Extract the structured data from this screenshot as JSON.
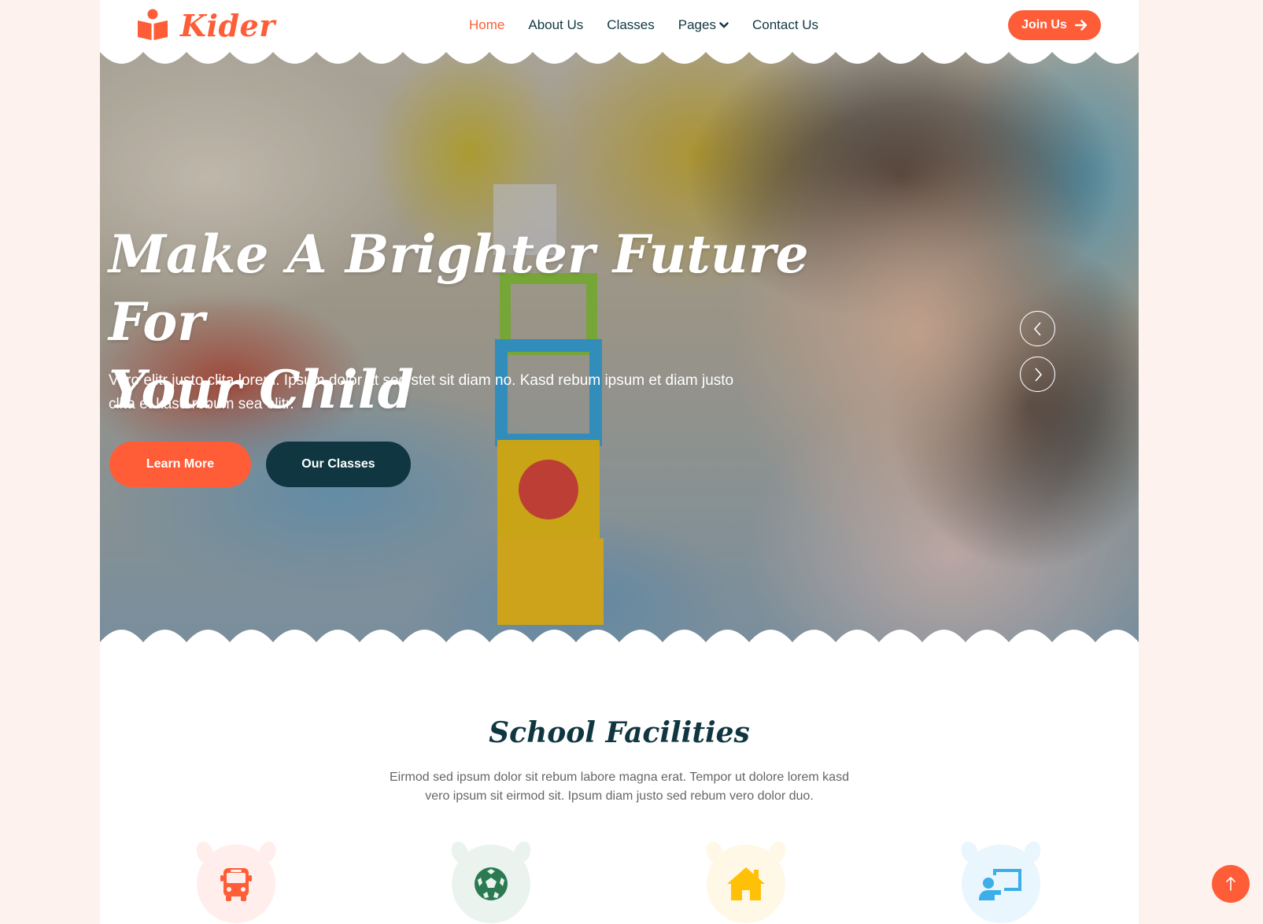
{
  "brand": {
    "name": "Kider",
    "icon": "book-reader-icon",
    "color": "#fe5d37"
  },
  "nav": {
    "home": "Home",
    "about": "About Us",
    "classes": "Classes",
    "pages": "Pages",
    "contact": "Contact Us",
    "join": "Join Us"
  },
  "hero": {
    "title_line1": "Make A Brighter Future For",
    "title_line2": "Your Child",
    "text_line1": "Vero elitr justo clita lorem. Ipsum dolor at sed stet sit diam no. Kasd rebum ipsum et diam justo",
    "text_line2": "clita et kasd rebum sea elitr.",
    "btn_primary": "Learn More",
    "btn_secondary": "Our Classes"
  },
  "facilities": {
    "title": "School Facilities",
    "text_line1": "Eirmod sed ipsum dolor sit rebum labore magna erat. Tempor ut dolore lorem kasd",
    "text_line2": "vero ipsum sit eirmod sit. Ipsum diam justo sed rebum vero dolor duo.",
    "items": [
      {
        "icon": "bus-icon",
        "color": "#fe5d37",
        "bg": "#ffeeeb"
      },
      {
        "icon": "football-icon",
        "color": "#2c7a52",
        "bg": "#eaf3ee"
      },
      {
        "icon": "home-icon",
        "color": "#ffc107",
        "bg": "#fff8e6"
      },
      {
        "icon": "teacher-icon",
        "color": "#3daee8",
        "bg": "#e9f6fd"
      }
    ]
  },
  "colors": {
    "primary": "#fe5d37",
    "dark": "#103741",
    "page_bg": "#fdf2ee"
  }
}
